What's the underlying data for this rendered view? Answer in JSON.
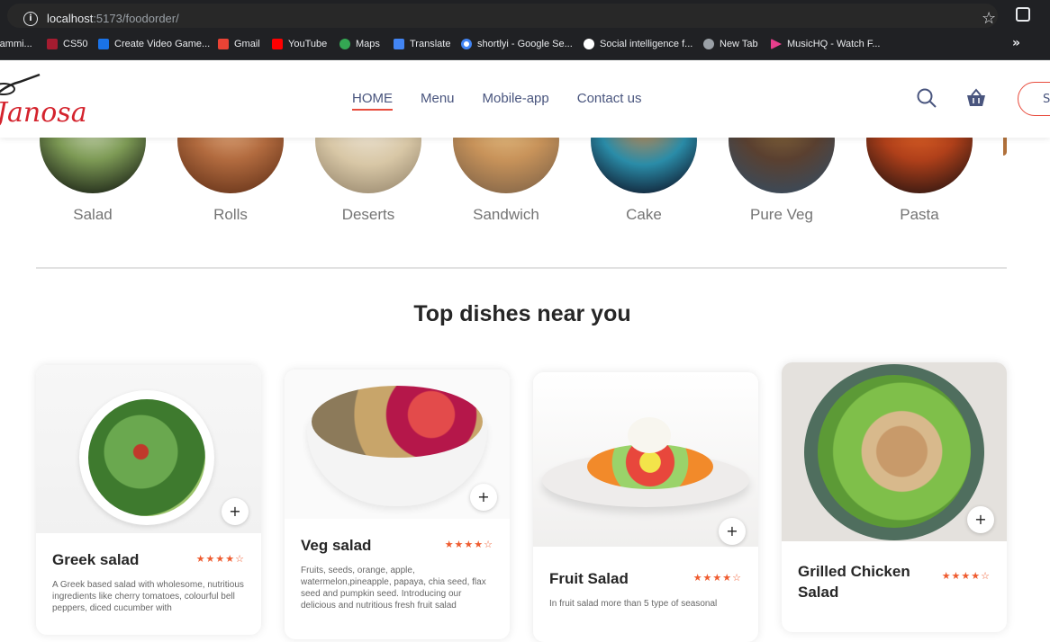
{
  "browser": {
    "url_host": "localhost",
    "url_path": ":5173/foodorder/",
    "bookmarks": [
      {
        "label": "rammi...",
        "icon": "folder-icon",
        "color": "#9aa0a6"
      },
      {
        "label": "CS50",
        "icon": "cs50-icon",
        "color": "#a51c30"
      },
      {
        "label": "Create Video Game...",
        "icon": "page-icon",
        "color": "#1a73e8"
      },
      {
        "label": "Gmail",
        "icon": "gmail-icon",
        "color": "#ea4335"
      },
      {
        "label": "YouTube",
        "icon": "youtube-icon",
        "color": "#ff0000"
      },
      {
        "label": "Maps",
        "icon": "maps-icon",
        "color": "#34a853"
      },
      {
        "label": "Translate",
        "icon": "translate-icon",
        "color": "#4285f4"
      },
      {
        "label": "shortlyi - Google Se...",
        "icon": "google-icon",
        "color": "#4285f4"
      },
      {
        "label": "Social intelligence f...",
        "icon": "site-icon",
        "color": "#ffffff"
      },
      {
        "label": "New Tab",
        "icon": "globe-icon",
        "color": "#9aa0a6"
      },
      {
        "label": "MusicHQ - Watch F...",
        "icon": "musichq-icon",
        "color": "#e83e8c"
      }
    ],
    "more": "»"
  },
  "header": {
    "logo": "Janosa",
    "nav": [
      "HOME",
      "Menu",
      "Mobile-app",
      "Contact us"
    ],
    "signin_label": "S"
  },
  "categories": [
    {
      "label": "Salad",
      "color": "#5f7a3f"
    },
    {
      "label": "Rolls",
      "color": "#b26b3f"
    },
    {
      "label": "Deserts",
      "color": "#c9b99a"
    },
    {
      "label": "Sandwich",
      "color": "#c8935a"
    },
    {
      "label": "Cake",
      "color": "#1f5a7a"
    },
    {
      "label": "Pure Veg",
      "color": "#6a4a32"
    },
    {
      "label": "Pasta",
      "color": "#8c3b1f"
    }
  ],
  "section_title": "Top dishes near you",
  "dishes": [
    {
      "name": "Greek salad",
      "rating": "★★★★☆",
      "desc": "A Greek based salad with wholesome, nutritious ingredients like cherry tomatoes, colourful bell peppers, diced cucumber with",
      "add": "+"
    },
    {
      "name": "Veg salad",
      "rating": "★★★★☆",
      "desc": "Fruits, seeds, orange, apple, watermelon,pineapple, papaya, chia seed, flax seed and pumpkin seed. Introducing our delicious and nutritious fresh fruit salad",
      "add": "+"
    },
    {
      "name": "Fruit Salad",
      "rating": "★★★★☆",
      "desc": "In fruit salad more than 5 type of seasonal",
      "add": "+"
    },
    {
      "name": "Grilled Chicken Salad",
      "rating": "★★★★☆",
      "desc": "",
      "add": "+"
    }
  ]
}
